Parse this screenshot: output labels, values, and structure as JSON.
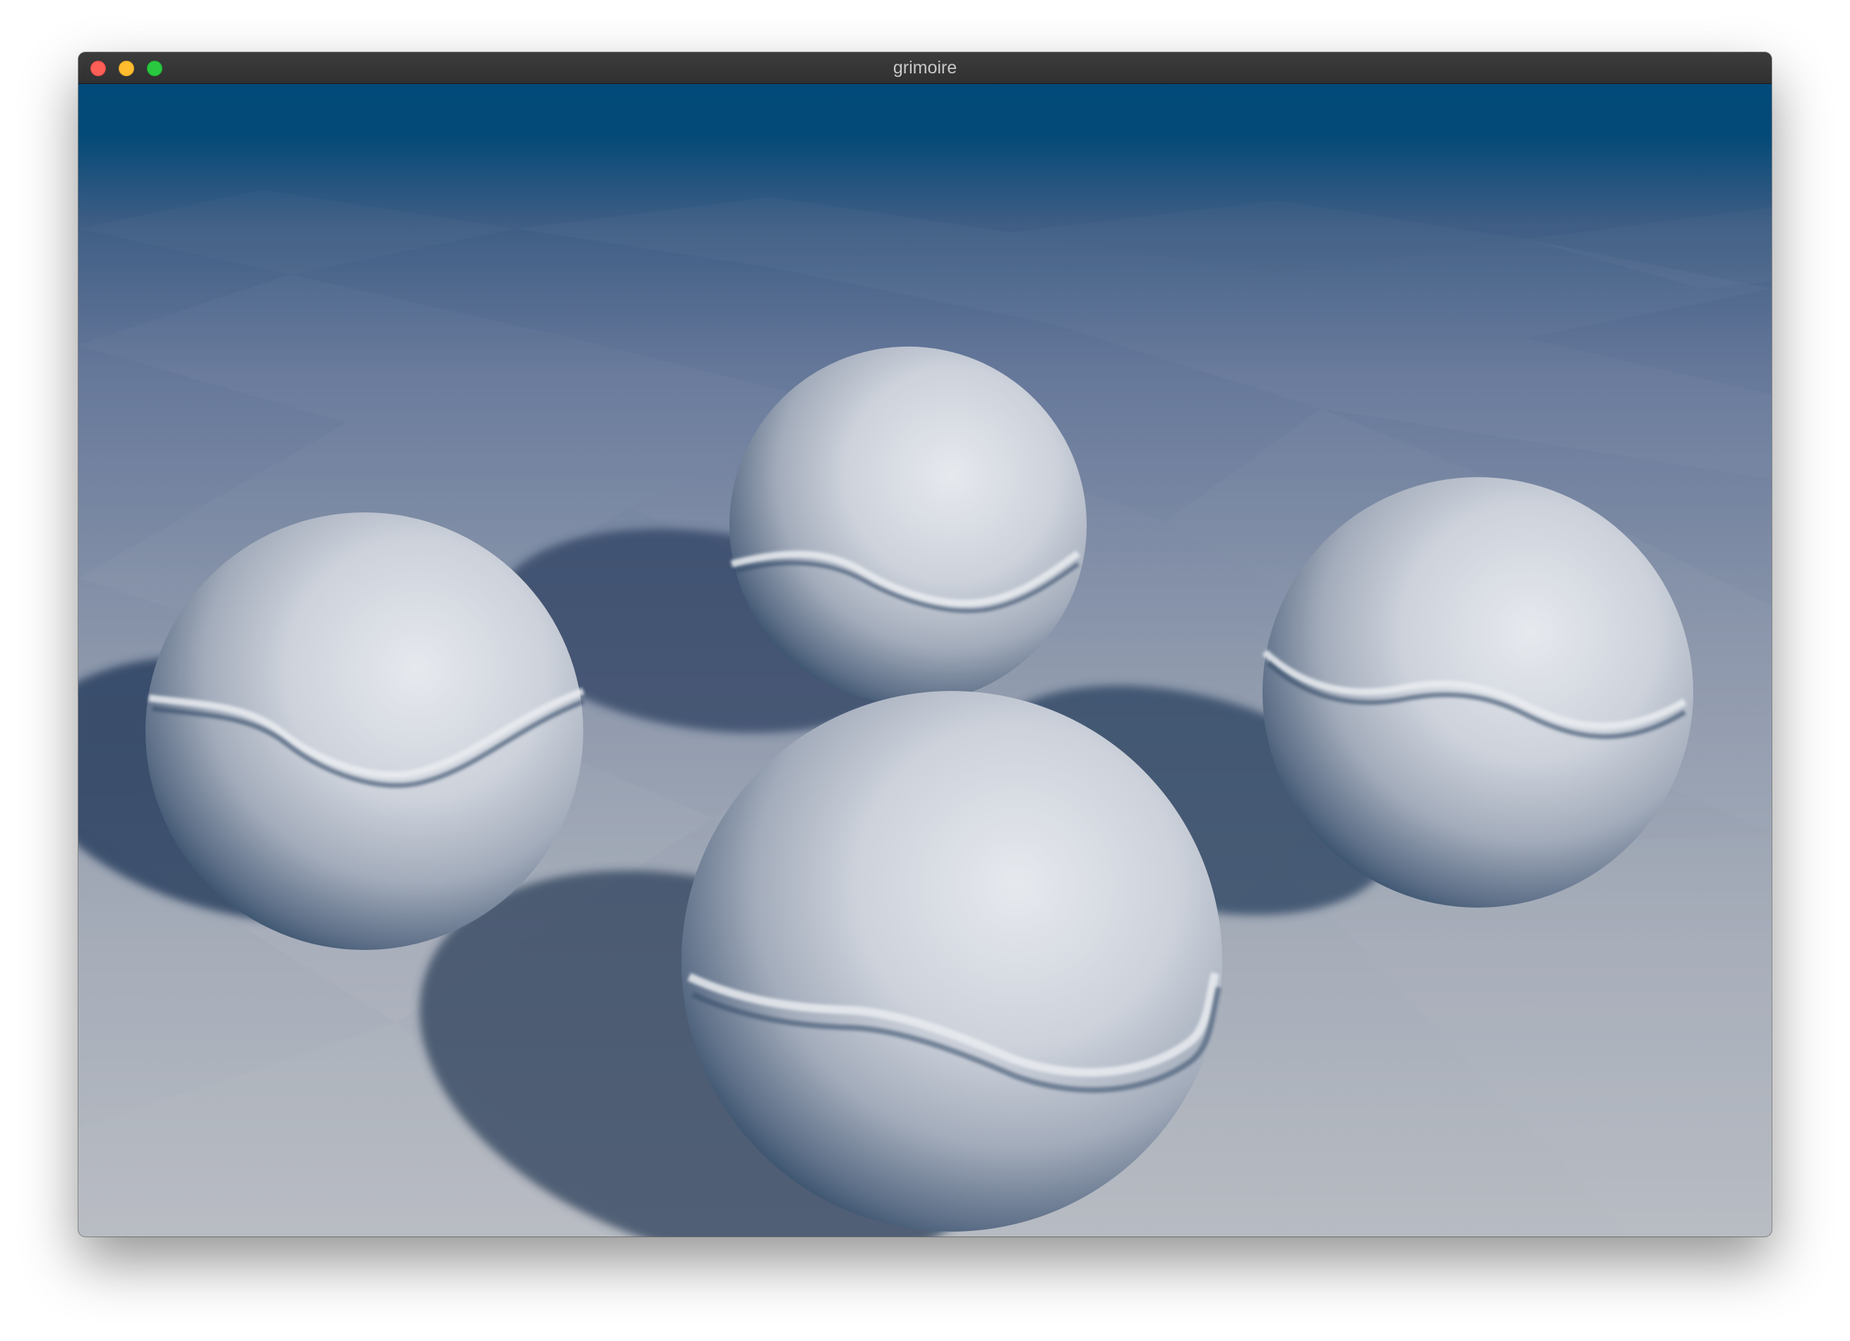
{
  "window": {
    "title": "grimoire",
    "buttons": {
      "close": "close-button",
      "minimize": "minimize-button",
      "zoom": "zoom-button"
    }
  },
  "scene": {
    "description_colors": {
      "sky_top": "#024a79",
      "floor_far": "#5e7393",
      "floor_near": "#b3b8bf",
      "sphere_light": "#e4e7ec",
      "sphere_shadow": "#0b2c4a",
      "cast_shadow": "#2a3e58"
    },
    "sphere_count": 4
  }
}
